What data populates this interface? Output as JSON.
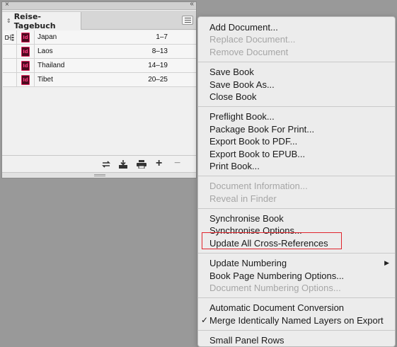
{
  "panel": {
    "close_glyph": "×",
    "collapse_glyph": "‹‹",
    "tab_chevron": "⌃⌄",
    "title": "Reise-Tagebuch",
    "documents": [
      {
        "name": "Japan",
        "pages": "1–7",
        "icon": "indesign-doc-icon",
        "icon_text": "Id",
        "synced_source": true
      },
      {
        "name": "Laos",
        "pages": "8–13",
        "icon": "indesign-doc-icon",
        "icon_text": "Id"
      },
      {
        "name": "Thailand",
        "pages": "14–19",
        "icon": "indesign-doc-icon",
        "icon_text": "Id"
      },
      {
        "name": "Tibet",
        "pages": "20–25",
        "icon": "indesign-doc-icon",
        "icon_text": "Id"
      }
    ],
    "footer_buttons": [
      "synchronize-icon",
      "save-book-icon",
      "print-book-icon",
      "add-document-icon",
      "remove-document-icon"
    ],
    "footer_glyphs": {
      "add": "+",
      "remove": "−"
    }
  },
  "menu": {
    "groups": [
      [
        {
          "label": "Add Document...",
          "enabled": true
        },
        {
          "label": "Replace Document...",
          "enabled": false
        },
        {
          "label": "Remove Document",
          "enabled": false
        }
      ],
      [
        {
          "label": "Save Book",
          "enabled": true
        },
        {
          "label": "Save Book As...",
          "enabled": true
        },
        {
          "label": "Close Book",
          "enabled": true
        }
      ],
      [
        {
          "label": "Preflight Book...",
          "enabled": true
        },
        {
          "label": "Package Book For Print...",
          "enabled": true
        },
        {
          "label": "Export Book to PDF...",
          "enabled": true
        },
        {
          "label": "Export Book to EPUB...",
          "enabled": true
        },
        {
          "label": "Print Book...",
          "enabled": true
        }
      ],
      [
        {
          "label": "Document Information...",
          "enabled": false
        },
        {
          "label": "Reveal in Finder",
          "enabled": false
        }
      ],
      [
        {
          "label": "Synchronise Book",
          "enabled": true
        },
        {
          "label": "Synchronise Options...",
          "enabled": true
        },
        {
          "label": "Update All Cross-References",
          "enabled": true,
          "highlighted": true
        }
      ],
      [
        {
          "label": "Update Numbering",
          "enabled": true,
          "submenu": true,
          "submenu_glyph": "▶"
        },
        {
          "label": "Book Page Numbering Options...",
          "enabled": true
        },
        {
          "label": "Document Numbering Options...",
          "enabled": false
        }
      ],
      [
        {
          "label": "Automatic Document Conversion",
          "enabled": true
        },
        {
          "label": "Merge Identically Named Layers on Export",
          "enabled": true,
          "checked": true,
          "check_glyph": "✓"
        }
      ],
      [
        {
          "label": "Small Panel Rows",
          "enabled": true
        }
      ]
    ],
    "highlight_color": "#e0242c"
  }
}
